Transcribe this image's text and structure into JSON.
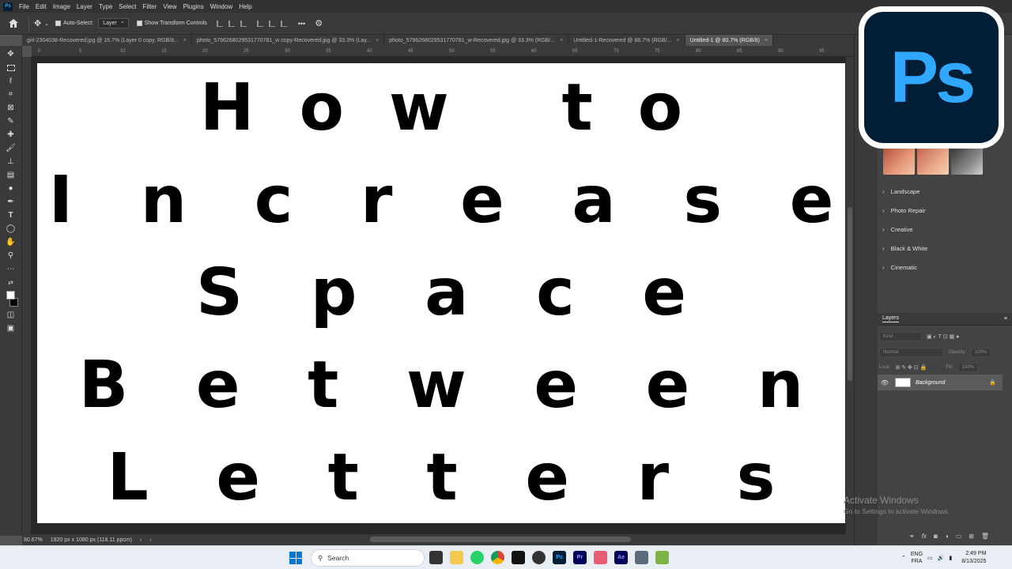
{
  "menu": {
    "app_icon": "Ps",
    "items": [
      "File",
      "Edit",
      "Image",
      "Layer",
      "Type",
      "Select",
      "Filter",
      "View",
      "Plugins",
      "Window",
      "Help"
    ]
  },
  "options": {
    "auto_select_label": "Auto-Select:",
    "auto_select_value": "Layer",
    "transform_label": "Show Transform Controls",
    "more_label": "•••"
  },
  "tabs": [
    "girl-2304038-Recovered.jpg @ 16.7% (Layer 0 copy, RGB/8...",
    "photo_5796268029531770781_w copy-Recovered.jpg @ 33.3% (Lay...",
    "photo_5796268029531770781_w-Recovered.jpg @ 33.3% (RGB/...",
    "Untitled-1-Recovered @ 88.7% (RGB/...",
    "Untitled-1 @ 80.7% (RGB/8)"
  ],
  "ruler": [
    "0",
    "5",
    "10",
    "15",
    "20",
    "25",
    "30",
    "35",
    "40",
    "45",
    "50",
    "55",
    "60",
    "65",
    "70",
    "75",
    "80",
    "85",
    "90",
    "95"
  ],
  "canvas_lines": [
    "H  o  w     t  o",
    "I   n   c   r   e   a   s   e",
    "S   p   a   c   e",
    "B   e   t   w   e   e   n",
    "L   e   t   t   e   r   s"
  ],
  "status": {
    "zoom": "80.67%",
    "doc_info": "1920 px x 1080 px (118.11 ppcm)"
  },
  "presets": [
    "Landscape",
    "Photo Repair",
    "Creative",
    "Black & White",
    "Cinematic"
  ],
  "layers": {
    "panel_title": "Layers",
    "kind_placeholder": "Kind",
    "blend_mode": "Normal",
    "opacity_label": "Opacity:",
    "opacity_value": "100%",
    "lock_label": "Lock:",
    "fill_label": "Fill:",
    "fill_value": "100%",
    "layer_name": "Background"
  },
  "logo_text": "Ps",
  "activation": {
    "title": "Activate Windows",
    "subtitle": "Go to Settings to activate Windows."
  },
  "taskbar": {
    "search_placeholder": "Search",
    "lang_1": "ENG",
    "lang_2": "FRA",
    "time": "2:49 PM",
    "date": "8/13/2025",
    "apps": [
      {
        "name": "file-explorer",
        "label": "",
        "color": "#f2c94c"
      },
      {
        "name": "whatsapp",
        "label": "",
        "color": "#25d366"
      },
      {
        "name": "chrome",
        "label": "",
        "color": "#db4437"
      },
      {
        "name": "capcut",
        "label": "",
        "color": "#111111"
      },
      {
        "name": "davinci",
        "label": "",
        "color": "#333333"
      },
      {
        "name": "photoshop",
        "label": "Ps",
        "color": "#001e36"
      },
      {
        "name": "premiere",
        "label": "Pr",
        "color": "#00005b"
      },
      {
        "name": "snipping",
        "label": "",
        "color": "#e85d75"
      },
      {
        "name": "after-effects",
        "label": "Ae",
        "color": "#00005b"
      },
      {
        "name": "calculator",
        "label": "",
        "color": "#5a6b7b"
      },
      {
        "name": "notepad",
        "label": "",
        "color": "#7cb342"
      }
    ]
  },
  "colors": {
    "ps_blue": "#31a8ff",
    "ps_dark": "#001e36",
    "workspace": "#535353"
  }
}
